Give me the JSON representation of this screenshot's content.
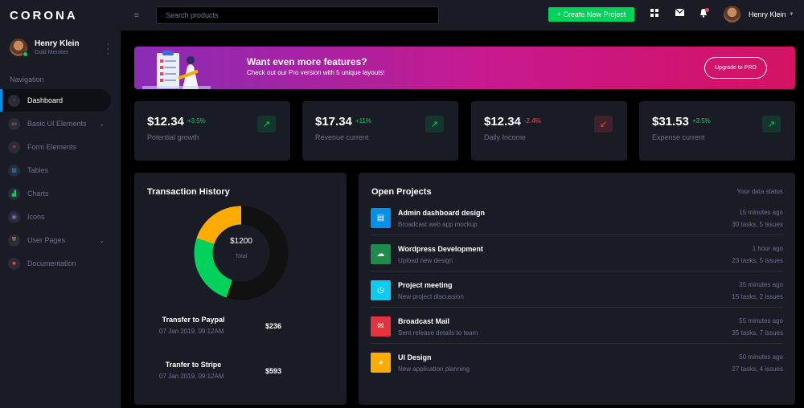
{
  "brand": "CORONA",
  "profile": {
    "name": "Henry Klein",
    "role": "Gold Member"
  },
  "nav": {
    "category": "Navigation",
    "items": [
      {
        "label": "Dashboard",
        "icon": "speedometer-icon",
        "color": "#8f5fe8"
      },
      {
        "label": "Basic UI Elements",
        "icon": "laptop-icon",
        "color": "#ffab00"
      },
      {
        "label": "Form Elements",
        "icon": "playlist-icon",
        "color": "#fc424a"
      },
      {
        "label": "Tables",
        "icon": "table-icon",
        "color": "#0090e7"
      },
      {
        "label": "Charts",
        "icon": "chart-icon",
        "color": "#00d25b"
      },
      {
        "label": "Icons",
        "icon": "contacts-icon",
        "color": "#8f5fe8"
      },
      {
        "label": "User Pages",
        "icon": "security-icon",
        "color": "#ffab00"
      },
      {
        "label": "Documentation",
        "icon": "document-icon",
        "color": "#fc424a"
      }
    ]
  },
  "topbar": {
    "search_placeholder": "Search products",
    "create_label": "+ Create New Project",
    "user_name": "Henry Klein"
  },
  "banner": {
    "heading": "Want even more features?",
    "sub": "Check out our Pro version with 5 unique layouts!",
    "button": "Upgrade to PRO"
  },
  "stats": [
    {
      "value": "$12.34",
      "change": "+3.5%",
      "label": "Potential growth",
      "trend": "up"
    },
    {
      "value": "$17.34",
      "change": "+11%",
      "label": "Revenue current",
      "trend": "up"
    },
    {
      "value": "$12.34",
      "change": "-2.4%",
      "label": "Daily Income",
      "trend": "down"
    },
    {
      "value": "$31.53",
      "change": "+3.5%",
      "label": "Expense current",
      "trend": "up"
    }
  ],
  "transactions": {
    "title": "Transaction History",
    "center_amount": "$1200",
    "center_label": "Total",
    "donut": [
      {
        "value": 55,
        "color": "#111111"
      },
      {
        "value": 25,
        "color": "#00d25b"
      },
      {
        "value": 20,
        "color": "#ffab00"
      }
    ],
    "items": [
      {
        "title": "Transfer to Paypal",
        "date": "07 Jan 2019, 09:12AM",
        "amount": "$236"
      },
      {
        "title": "Tranfer to Stripe",
        "date": "07 Jan 2019, 09:12AM",
        "amount": "$593"
      }
    ]
  },
  "projects": {
    "title": "Open Projects",
    "status": "Your data status",
    "items": [
      {
        "title": "Admin dashboard design",
        "sub": "Broadcast web app mockup",
        "time": "15 minutes ago",
        "tasks": "30 tasks, 5 issues",
        "color": "#0090e7",
        "icon": "file-icon"
      },
      {
        "title": "Wordpress Development",
        "sub": "Upload new design",
        "time": "1 hour ago",
        "tasks": "23 tasks, 5 issues",
        "color": "#00d25b",
        "icon": "cloud-upload-icon"
      },
      {
        "title": "Project meeting",
        "sub": "New project discussion",
        "time": "35 minutes ago",
        "tasks": "15 tasks, 2 issues",
        "color": "#0dcaf0",
        "icon": "clock-icon"
      },
      {
        "title": "Broadcast Mail",
        "sub": "Sent release details to team",
        "time": "55 minutes ago",
        "tasks": "35 tasks, 7 issues",
        "color": "#fc424a",
        "icon": "email-open-icon"
      },
      {
        "title": "UI Design",
        "sub": "New application planning",
        "time": "50 minutes ago",
        "tasks": "27 tasks, 4 issues",
        "color": "#ffab00",
        "icon": "chart-pie-icon"
      }
    ]
  }
}
